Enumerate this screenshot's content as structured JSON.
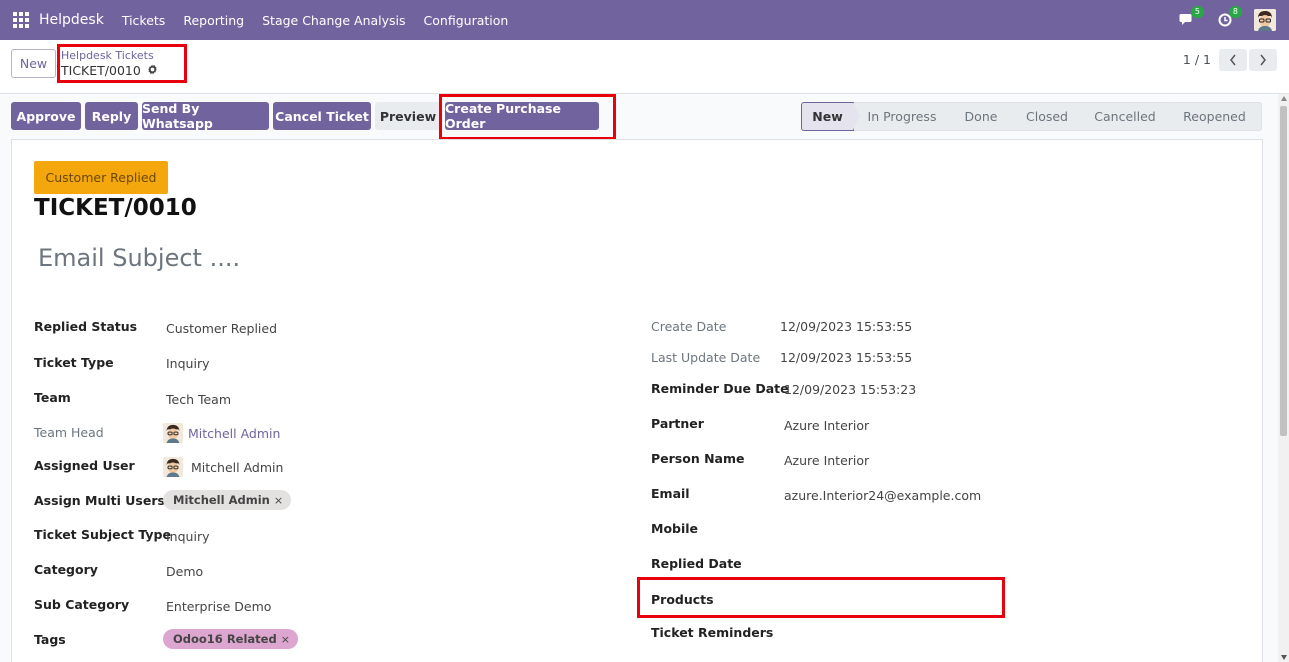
{
  "navbar": {
    "brand": "Helpdesk",
    "menu": [
      "Tickets",
      "Reporting",
      "Stage Change Analysis",
      "Configuration"
    ],
    "messages_count": "5",
    "activities_count": "8",
    "bg_color": "#71639e"
  },
  "control_panel": {
    "new_label": "New",
    "breadcrumb_parent": "Helpdesk Tickets",
    "breadcrumb_current": "TICKET/0010",
    "pager": "1 / 1"
  },
  "actions": {
    "approve": "Approve",
    "reply": "Reply",
    "send_whatsapp": "Send By Whatsapp",
    "cancel_ticket": "Cancel Ticket",
    "preview": "Preview",
    "create_po": "Create Purchase Order"
  },
  "stages": [
    "New",
    "In Progress",
    "Done",
    "Closed",
    "Cancelled",
    "Reopened"
  ],
  "active_stage": "New",
  "form": {
    "ribbon": "Customer Replied",
    "ticket_name": "TICKET/0010",
    "email_subject_placeholder": "Email Subject ....",
    "left": {
      "replied_status": {
        "label": "Replied Status",
        "value": "Customer Replied"
      },
      "ticket_type": {
        "label": "Ticket Type",
        "value": "Inquiry"
      },
      "team": {
        "label": "Team",
        "value": "Tech Team"
      },
      "team_head": {
        "label": "Team Head",
        "value": "Mitchell Admin"
      },
      "assigned_user": {
        "label": "Assigned User",
        "value": "Mitchell Admin"
      },
      "assign_multi_users": {
        "label": "Assign Multi Users",
        "tag": "Mitchell Admin"
      },
      "ticket_subject_type": {
        "label": "Ticket Subject Type",
        "value": "Inquiry"
      },
      "category": {
        "label": "Category",
        "value": "Demo"
      },
      "sub_category": {
        "label": "Sub Category",
        "value": "Enterprise Demo"
      },
      "tags": {
        "label": "Tags",
        "tag": "Odoo16 Related"
      }
    },
    "right": {
      "create_date": {
        "label": "Create Date",
        "value": "12/09/2023 15:53:55"
      },
      "last_update_date": {
        "label": "Last Update Date",
        "value": "12/09/2023 15:53:55"
      },
      "reminder_due_date": {
        "label": "Reminder Due Date",
        "value": "12/09/2023 15:53:23"
      },
      "partner": {
        "label": "Partner",
        "value": "Azure Interior"
      },
      "person_name": {
        "label": "Person Name",
        "value": "Azure Interior"
      },
      "email": {
        "label": "Email",
        "value": "azure.Interior24@example.com"
      },
      "mobile": {
        "label": "Mobile",
        "value": ""
      },
      "replied_date": {
        "label": "Replied Date",
        "value": ""
      },
      "products": {
        "label": "Products",
        "value": ""
      },
      "ticket_reminders": {
        "label": "Ticket Reminders",
        "value": ""
      }
    }
  },
  "colors": {
    "primary": "#71639e",
    "ribbon": "#f3a70d",
    "highlight": "#e8000d",
    "tag_user": "#e4e1e1",
    "tag_odoo": "#dda6d0"
  }
}
